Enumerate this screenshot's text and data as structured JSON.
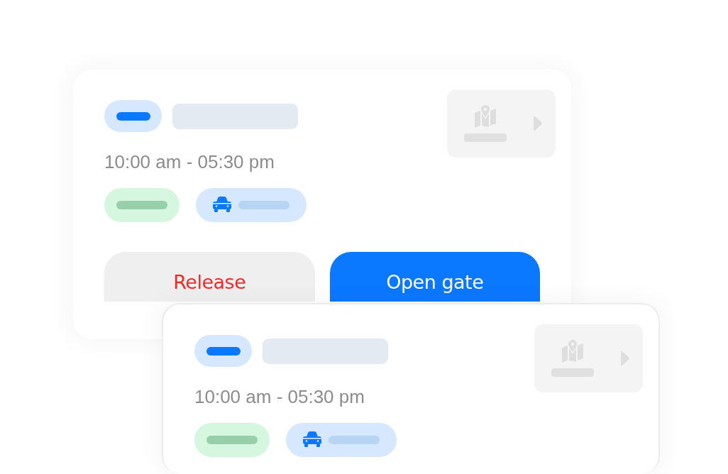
{
  "cards": [
    {
      "time": "10:00 am - 05:30 pm",
      "buttons": [
        {
          "label": "Release",
          "kind": "secondary"
        },
        {
          "label": "Open gate",
          "kind": "primary"
        }
      ]
    },
    {
      "time": "10:00 am - 05:30 pm"
    }
  ]
}
